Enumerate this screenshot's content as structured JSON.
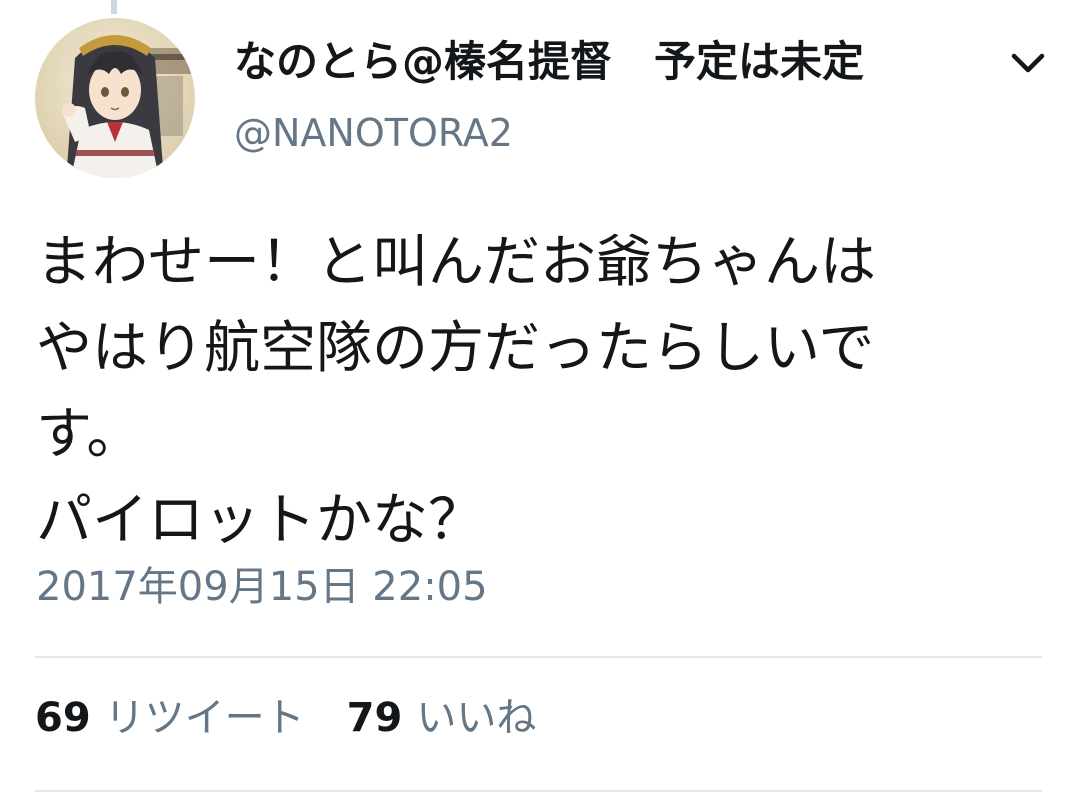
{
  "tweet": {
    "author": {
      "display_name": "なのとら@榛名提督　予定は未定",
      "handle": "@NANOTORA2"
    },
    "text_lines": [
      "まわせー！と叫んだお爺ちゃんは",
      "やはり航空隊の方だったらしいで",
      "す。",
      "パイロットかな？"
    ],
    "timestamp": "2017年09月15日 22:05",
    "stats": {
      "retweets_count": "69",
      "retweets_label": "リツイート",
      "likes_count": "79",
      "likes_label": "いいね"
    },
    "icons": {
      "menu": "chevron-down-icon",
      "avatar": "avatar"
    },
    "colors": {
      "primary_text": "#14171a",
      "secondary_text": "#657786",
      "divider": "#e1e8ed",
      "background": "#ffffff"
    }
  }
}
